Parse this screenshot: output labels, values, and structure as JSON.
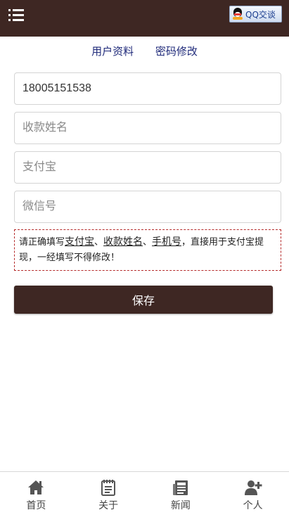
{
  "header": {
    "qq_label": "QQ交谈"
  },
  "subnav": {
    "items": [
      {
        "label": "用户资料"
      },
      {
        "label": "密码修改"
      }
    ]
  },
  "form": {
    "phone_value": "18005151538",
    "name_placeholder": "收款姓名",
    "alipay_placeholder": "支付宝",
    "wechat_placeholder": "微信号",
    "save_label": "保存"
  },
  "notice": {
    "prefix": "请正确填写",
    "alipay": "支付宝",
    "sep1": "、",
    "name": "收款姓名",
    "sep2": "、",
    "phone": "手机号",
    "suffix": "，直接用于支付宝提现，一经填写不得修改！"
  },
  "bottom_nav": {
    "items": [
      {
        "label": "首页",
        "icon": "home-icon"
      },
      {
        "label": "关于",
        "icon": "notebook-icon"
      },
      {
        "label": "新闻",
        "icon": "newspaper-icon"
      },
      {
        "label": "个人",
        "icon": "add-user-icon"
      }
    ]
  },
  "colors": {
    "brand": "#3e2723",
    "notice_border": "#b52b2b",
    "link": "#1f2a7a"
  }
}
